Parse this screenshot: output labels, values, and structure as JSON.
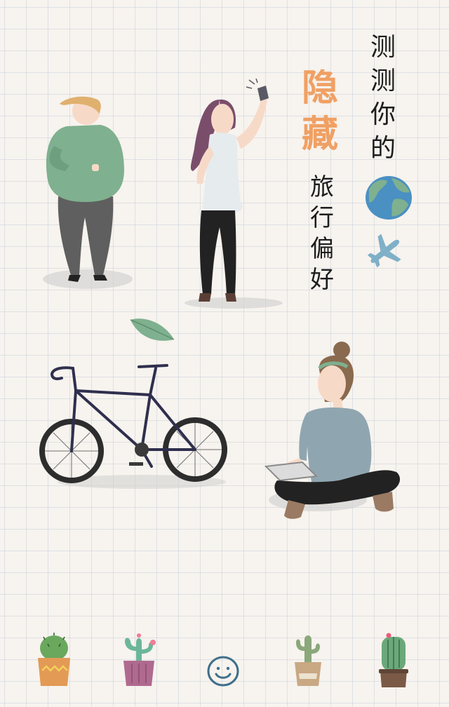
{
  "title": {
    "line1": [
      "测",
      "测",
      "你",
      "的"
    ],
    "accent": [
      "隐",
      "藏"
    ],
    "line2": [
      "旅",
      "行",
      "偏",
      "好"
    ]
  },
  "colors": {
    "background": "#f7f3ee",
    "grid": "#a0b4cd",
    "accent": "#f0a064",
    "text": "#1d1d1d",
    "green": "#7fb08f",
    "blue": "#4a90c2",
    "plane": "#7fb0c8"
  },
  "illustrations": [
    "man-illustration",
    "woman-selfie-illustration",
    "globe-icon",
    "airplane-icon",
    "leaf-icon",
    "bicycle-illustration",
    "woman-tablet-illustration"
  ],
  "bottom_bar": {
    "items": [
      "cactus-pot-icon",
      "flower-cactus-icon",
      "smiley-icon",
      "tall-cactus-icon",
      "barrel-cactus-icon"
    ]
  }
}
